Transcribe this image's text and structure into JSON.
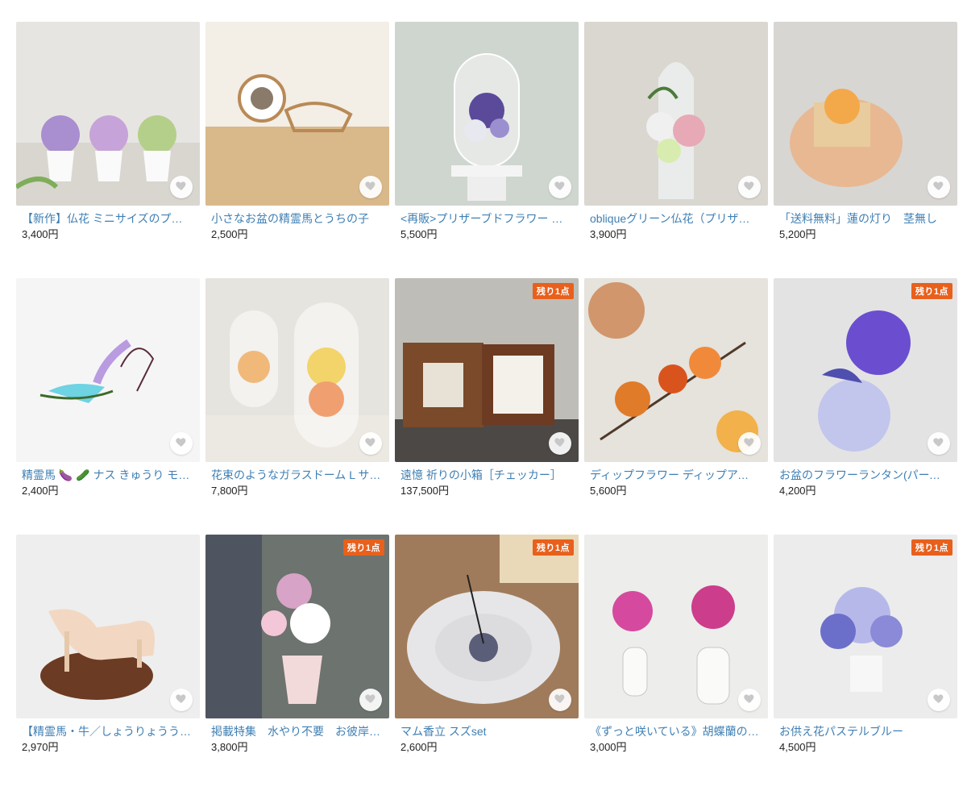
{
  "products": [
    {
      "title": "【新作】仏花 ミニサイズのプリザーブドフラワー",
      "price": "3,400円",
      "badge": "",
      "bg": "#e7e5e2",
      "accent": "#a98ed0"
    },
    {
      "title": "小さなお盆の精霊馬とうちの子",
      "price": "2,500円",
      "badge": "",
      "bg": "#efe7db",
      "accent": "#b98a56"
    },
    {
      "title": "<再販>プリザーブドフラワー ガラスドーム",
      "price": "5,500円",
      "badge": "",
      "bg": "#cfd6cf",
      "accent": "#5b4a9a"
    },
    {
      "title": "obliqueグリーン仏花（プリザーブドフラワー）",
      "price": "3,900円",
      "badge": "",
      "bg": "#dad7d1",
      "accent": "#e7a9b6"
    },
    {
      "title": "「送料無料」蓮の灯り　茎無し",
      "price": "5,200円",
      "badge": "",
      "bg": "#d8d6d2",
      "accent": "#f3a94a"
    },
    {
      "title": "精霊馬 🍆 🥒 ナス きゅうり モビール",
      "price": "2,400円",
      "badge": "",
      "bg": "#f6f5f6",
      "accent": "#b89be0"
    },
    {
      "title": "花束のようなガラスドーム L サイズ",
      "price": "7,800円",
      "badge": "",
      "bg": "#e6e4df",
      "accent": "#f0b97a"
    },
    {
      "title": "遠憶 祈りの小箱［チェッカー］",
      "price": "137,500円",
      "badge": "残り1点",
      "bg": "#bfbdb8",
      "accent": "#7a4a2a"
    },
    {
      "title": "ディップフラワー ディップアート 鬼灯",
      "price": "5,600円",
      "badge": "",
      "bg": "#e6e2dc",
      "accent": "#e07b2a"
    },
    {
      "title": "お盆のフラワーランタン(パープル)",
      "price": "4,200円",
      "badge": "残り1点",
      "bg": "#e4e3e4",
      "accent": "#6a4ecf"
    },
    {
      "title": "【精霊馬・牛／しょうりょううま】木製",
      "price": "2,970円",
      "badge": "",
      "bg": "#eeeeee",
      "accent": "#6c3b24"
    },
    {
      "title": "掲載特集　水やり不要　お彼岸・お盆の仏花",
      "price": "3,800円",
      "badge": "残り1点",
      "bg": "#6d736e",
      "accent": "#d7a3c6"
    },
    {
      "title": "マム香立 スズset",
      "price": "2,600円",
      "badge": "残り1点",
      "bg": "#a07b5b",
      "accent": "#5a5e78"
    },
    {
      "title": "《ずっと咲いている》胡蝶蘭の仏花",
      "price": "3,000円",
      "badge": "",
      "bg": "#ededeb",
      "accent": "#d54a9e"
    },
    {
      "title": "お供え花パステルブルー",
      "price": "4,500円",
      "badge": "残り1点",
      "bg": "#ececec",
      "accent": "#6b6fc9"
    }
  ],
  "icons": {
    "favorite": "heart-icon"
  }
}
